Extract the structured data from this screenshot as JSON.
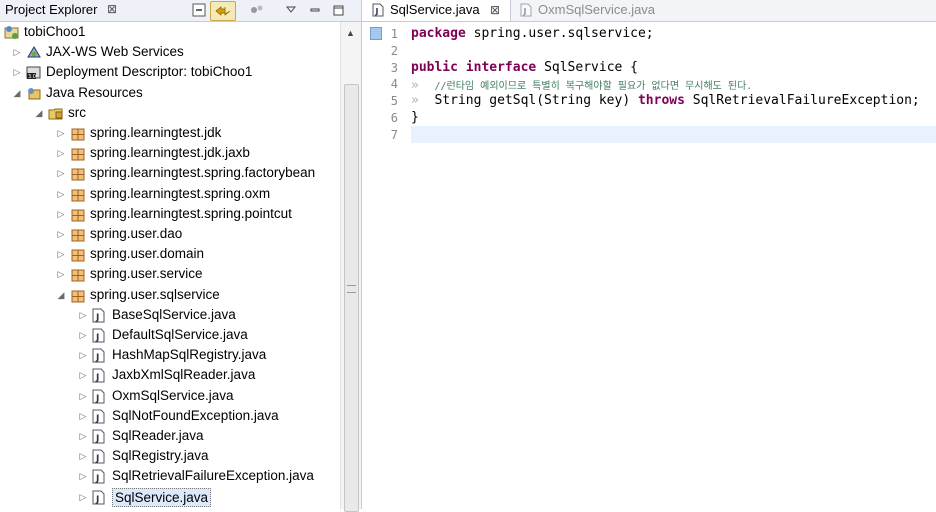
{
  "project_explorer": {
    "title": "Project Explorer",
    "close_glyph": "⊠",
    "items": [
      {
        "label": "tobiChoo1",
        "depth": 0,
        "expanded": true,
        "icon": "project-icon"
      },
      {
        "label": "JAX-WS Web Services",
        "depth": 1,
        "expanded": false,
        "icon": "web-services-icon"
      },
      {
        "label": "Deployment Descriptor: tobiChoo1",
        "depth": 1,
        "expanded": false,
        "icon": "deployment-descriptor-icon"
      },
      {
        "label": "Java Resources",
        "depth": 1,
        "expanded": true,
        "icon": "java-resources-icon"
      },
      {
        "label": "src",
        "depth": 2,
        "expanded": true,
        "icon": "source-folder-icon"
      },
      {
        "label": "spring.learningtest.jdk",
        "depth": 3,
        "expanded": false,
        "icon": "package-icon"
      },
      {
        "label": "spring.learningtest.jdk.jaxb",
        "depth": 3,
        "expanded": false,
        "icon": "package-icon"
      },
      {
        "label": "spring.learningtest.spring.factorybean",
        "depth": 3,
        "expanded": false,
        "icon": "package-icon"
      },
      {
        "label": "spring.learningtest.spring.oxm",
        "depth": 3,
        "expanded": false,
        "icon": "package-icon"
      },
      {
        "label": "spring.learningtest.spring.pointcut",
        "depth": 3,
        "expanded": false,
        "icon": "package-icon"
      },
      {
        "label": "spring.user.dao",
        "depth": 3,
        "expanded": false,
        "icon": "package-icon"
      },
      {
        "label": "spring.user.domain",
        "depth": 3,
        "expanded": false,
        "icon": "package-icon"
      },
      {
        "label": "spring.user.service",
        "depth": 3,
        "expanded": false,
        "icon": "package-icon"
      },
      {
        "label": "spring.user.sqlservice",
        "depth": 3,
        "expanded": true,
        "icon": "package-icon"
      },
      {
        "label": "BaseSqlService.java",
        "depth": 4,
        "expanded": false,
        "icon": "java-file-icon"
      },
      {
        "label": "DefaultSqlService.java",
        "depth": 4,
        "expanded": false,
        "icon": "java-file-icon"
      },
      {
        "label": "HashMapSqlRegistry.java",
        "depth": 4,
        "expanded": false,
        "icon": "java-file-icon"
      },
      {
        "label": "JaxbXmlSqlReader.java",
        "depth": 4,
        "expanded": false,
        "icon": "java-file-icon"
      },
      {
        "label": "OxmSqlService.java",
        "depth": 4,
        "expanded": false,
        "icon": "java-file-icon"
      },
      {
        "label": "SqlNotFoundException.java",
        "depth": 4,
        "expanded": false,
        "icon": "java-file-icon"
      },
      {
        "label": "SqlReader.java",
        "depth": 4,
        "expanded": false,
        "icon": "java-file-icon"
      },
      {
        "label": "SqlRegistry.java",
        "depth": 4,
        "expanded": false,
        "icon": "java-file-icon"
      },
      {
        "label": "SqlRetrievalFailureException.java",
        "depth": 4,
        "expanded": false,
        "icon": "java-file-icon"
      },
      {
        "label": "SqlService.java",
        "depth": 4,
        "expanded": false,
        "icon": "java-file-icon",
        "selected": true
      }
    ]
  },
  "editor": {
    "tabs": [
      {
        "label": "SqlService.java",
        "active": true,
        "close_glyph": "⊠"
      },
      {
        "label": "OxmSqlService.java",
        "active": false
      }
    ],
    "line_numbers": [
      "1",
      "2",
      "3",
      "4",
      "5",
      "6",
      "7"
    ],
    "code": {
      "l1_kw": "package",
      "l1_rest": " spring.user.sqlservice;",
      "l3_kw1": "public",
      "l3_kw2": "interface",
      "l3_rest": " SqlService {",
      "tab_glyph": "»",
      "l4_comment": "//런타임 예외이므로 특별히 복구해야할 필요가 없다면 무시해도 된다.",
      "l5_a": "String getSql(String key) ",
      "l5_kw": "throws",
      "l5_b": " SqlRetrievalFailureException;",
      "l6": "}"
    }
  },
  "colors": {
    "keyword": "#7f0055",
    "comment": "#3f7f5f",
    "current_line": "#e8f2fe",
    "selection": "#dce8fb"
  }
}
